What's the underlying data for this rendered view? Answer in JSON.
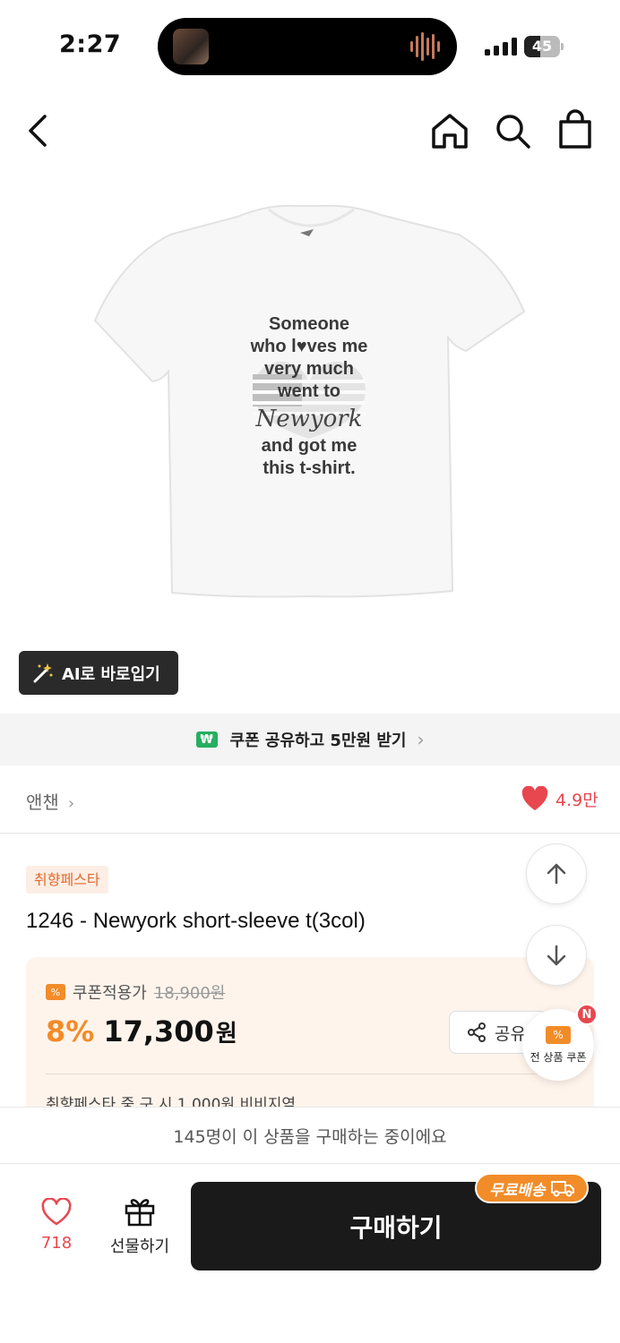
{
  "status_bar": {
    "time": "2:27",
    "battery": "45",
    "battery_level": 0.45
  },
  "product_image_text": {
    "line1": "Someone",
    "line2": "who l♥ves me",
    "line3": "very much",
    "line4": "went to",
    "script": "Newyork",
    "line5": "and got me",
    "line6": "this t-shirt."
  },
  "ai_button": {
    "label": "AI로 바로입기"
  },
  "coupon_banner": {
    "badge": "₩",
    "text": "쿠폰 공유하고 5만원 받기"
  },
  "brand": {
    "name": "앤챈"
  },
  "likes": {
    "top": "4.9만",
    "bottom": "718"
  },
  "product": {
    "tag": "취향페스타",
    "title": "1246 - Newyork short-sleeve t(3col)",
    "coupon_label": "쿠폰적용가",
    "original_price": "18,900원",
    "discount": "8%",
    "price": "17,300",
    "price_unit": "원",
    "share_label": "공유",
    "more_line": "취향페스타 중 구 시 1,000원 비비지역"
  },
  "float_coupon": {
    "label": "전 상품 쿠폰",
    "badge": "N"
  },
  "buyers_bar": {
    "text": "145명이 이 상품을 구매하는 중이에요"
  },
  "bottom": {
    "gift_label": "선물하기",
    "buy_label": "구매하기",
    "free_ship": "무료배송"
  },
  "colors": {
    "accent": "#f28c28",
    "like": "#e8474f",
    "dark": "#1a1a1a"
  }
}
